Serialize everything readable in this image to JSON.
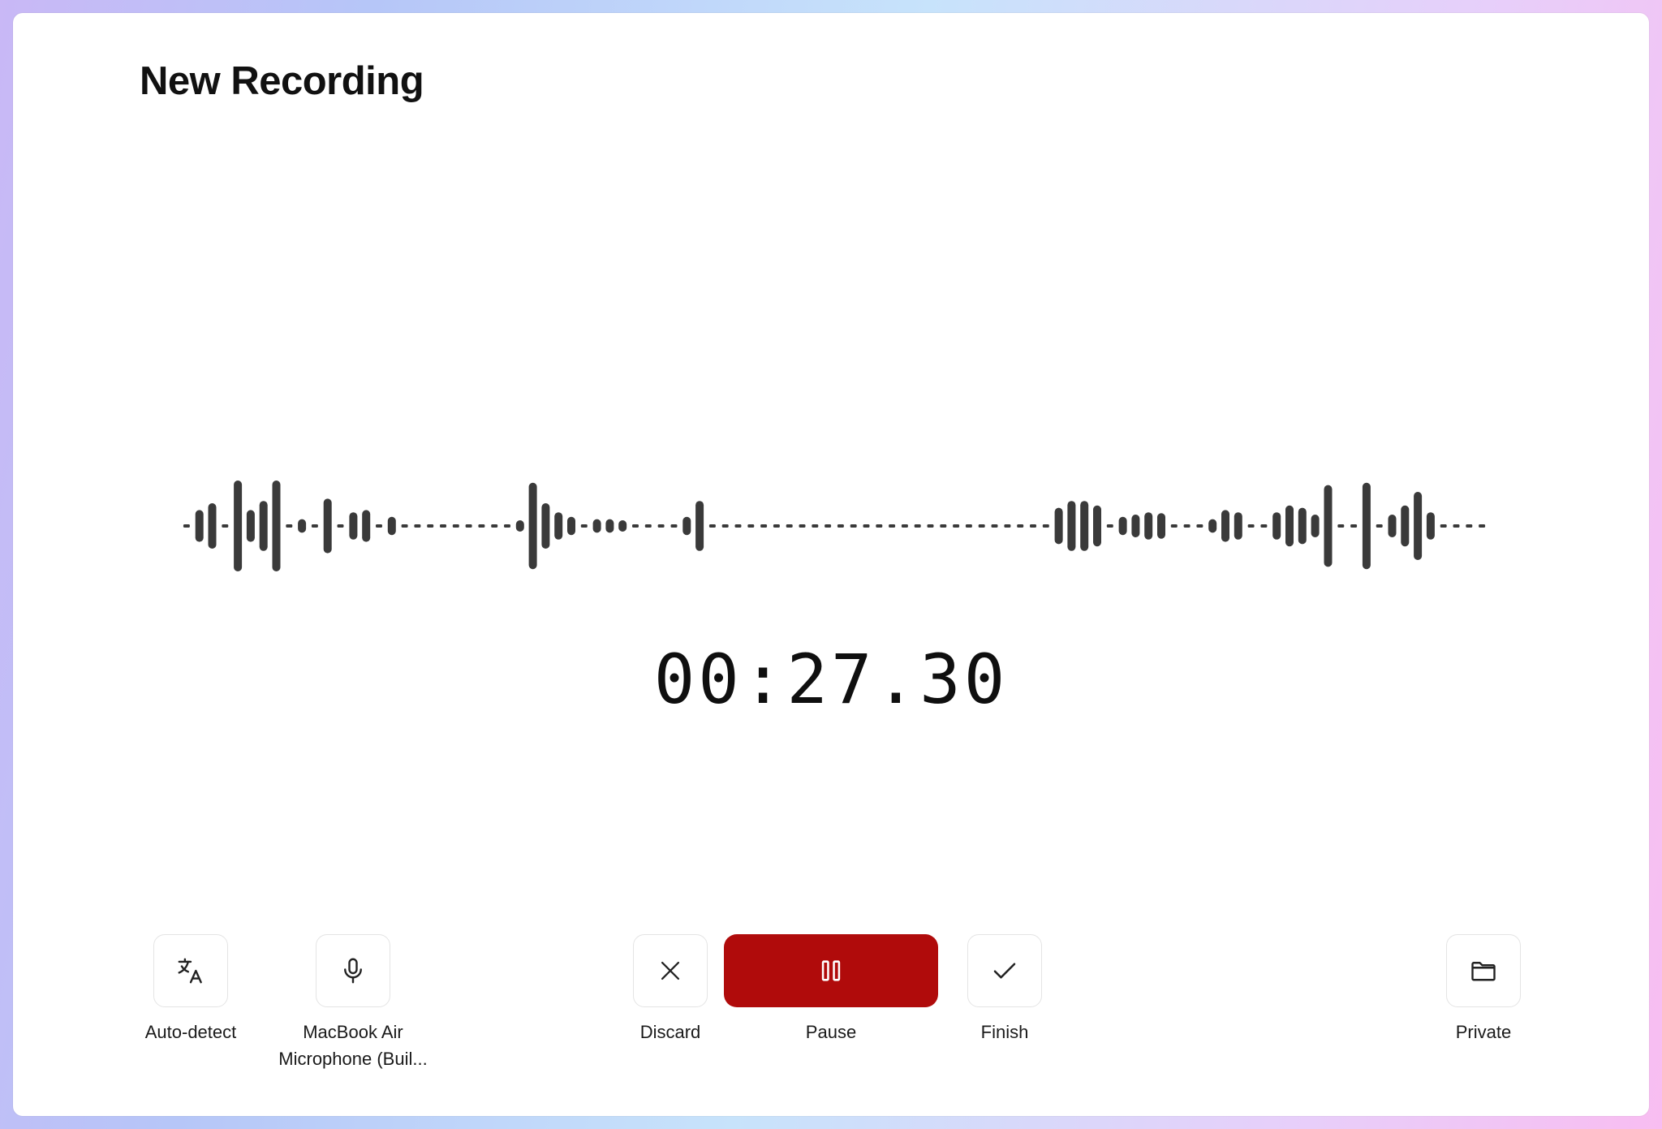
{
  "window": {
    "title": "New Recording"
  },
  "recording": {
    "elapsed": "00:27.30"
  },
  "colors": {
    "accent": "#b00b0b",
    "waveform": "#3a3a3a",
    "border": "#e4e4e4"
  },
  "waveform": {
    "levels": [
      0.05,
      0.35,
      0.5,
      0.02,
      1.0,
      0.35,
      0.55,
      1.0,
      0.02,
      0.15,
      0.02,
      0.6,
      0.02,
      0.3,
      0.35,
      0.02,
      0.2,
      0.02,
      0.02,
      0.02,
      0.02,
      0.02,
      0.02,
      0.02,
      0.02,
      0.02,
      0.12,
      0.95,
      0.5,
      0.3,
      0.2,
      0.02,
      0.15,
      0.15,
      0.12,
      0.02,
      0.02,
      0.02,
      0.02,
      0.2,
      0.55,
      0.02,
      0.02,
      0.02,
      0.02,
      0.02,
      0.02,
      0.02,
      0.02,
      0.02,
      0.02,
      0.02,
      0.02,
      0.02,
      0.02,
      0.02,
      0.02,
      0.02,
      0.02,
      0.02,
      0.02,
      0.02,
      0.02,
      0.02,
      0.02,
      0.02,
      0.02,
      0.02,
      0.4,
      0.55,
      0.55,
      0.45,
      0.02,
      0.2,
      0.25,
      0.3,
      0.28,
      0.02,
      0.02,
      0.02,
      0.15,
      0.35,
      0.3,
      0.02,
      0.02,
      0.3,
      0.45,
      0.4,
      0.25,
      0.9,
      0.02,
      0.02,
      0.95,
      0.02,
      0.25,
      0.45,
      0.75,
      0.3,
      0.02,
      0.02,
      0.02,
      0.02
    ]
  },
  "controls": {
    "language": {
      "label": "Auto-detect",
      "icon": "translate-icon"
    },
    "microphone": {
      "label_lines": [
        "MacBook Air",
        "Microphone (Buil..."
      ],
      "icon": "microphone-icon"
    },
    "discard": {
      "label": "Discard",
      "icon": "close-icon"
    },
    "pause": {
      "label": "Pause",
      "icon": "pause-icon"
    },
    "finish": {
      "label": "Finish",
      "icon": "check-icon"
    },
    "privacy": {
      "label": "Private",
      "icon": "folder-icon"
    }
  }
}
